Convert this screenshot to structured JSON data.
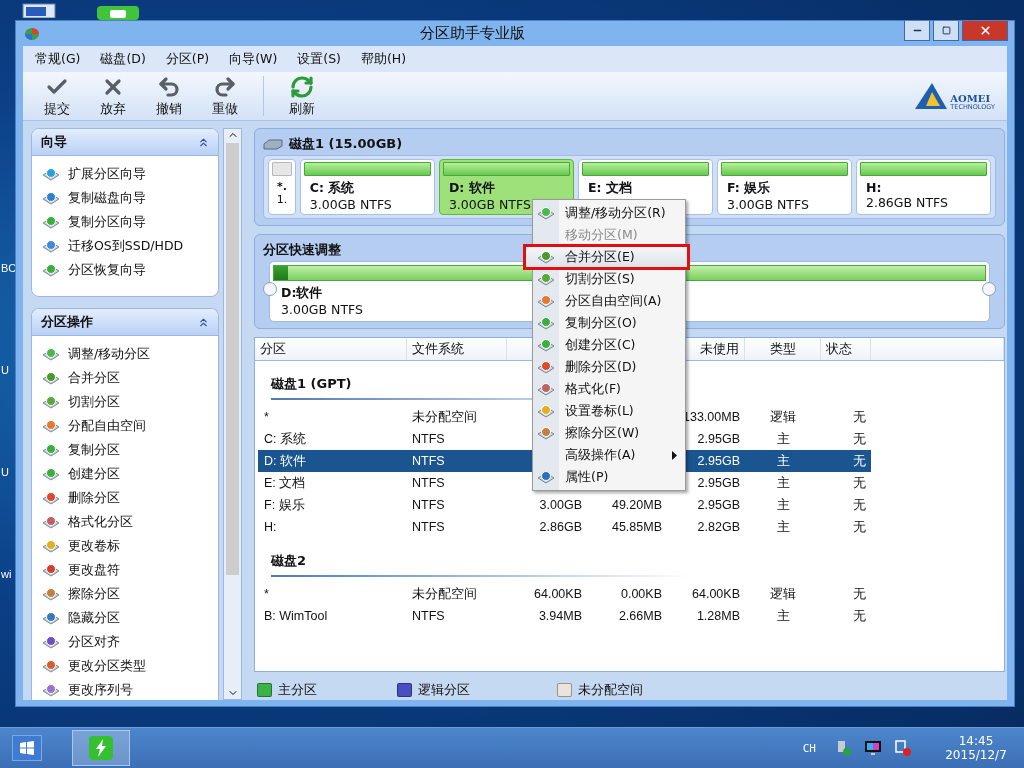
{
  "desktop_labels": [
    "BC",
    "U",
    "U",
    "wi"
  ],
  "window": {
    "title": "分区助手专业版"
  },
  "menu": [
    "常规(G)",
    "磁盘(D)",
    "分区(P)",
    "向导(W)",
    "设置(S)",
    "帮助(H)"
  ],
  "toolbar": [
    {
      "kind": "commit",
      "label": "提交"
    },
    {
      "kind": "discard",
      "label": "放弃"
    },
    {
      "kind": "undo",
      "label": "撤销"
    },
    {
      "kind": "redo",
      "label": "重做"
    },
    {
      "kind": "refresh",
      "label": "刷新"
    }
  ],
  "logo": {
    "name": "AOMEI",
    "tagline": "TECHNOLOGY"
  },
  "sidebar": [
    {
      "title": "向导",
      "expanded": true,
      "items": [
        {
          "kind": "extend",
          "label": "扩展分区向导"
        },
        {
          "kind": "copydisk",
          "label": "复制磁盘向导"
        },
        {
          "kind": "copy",
          "label": "复制分区向导"
        },
        {
          "kind": "migrate",
          "label": "迁移OS到SSD/HDD"
        },
        {
          "kind": "recover",
          "label": "分区恢复向导"
        }
      ]
    },
    {
      "title": "分区操作",
      "expanded": true,
      "items": [
        {
          "kind": "resize",
          "label": "调整/移动分区"
        },
        {
          "kind": "merge",
          "label": "合并分区"
        },
        {
          "kind": "split",
          "label": "切割分区"
        },
        {
          "kind": "allocate",
          "label": "分配自由空间"
        },
        {
          "kind": "copy",
          "label": "复制分区"
        },
        {
          "kind": "create",
          "label": "创建分区"
        },
        {
          "kind": "delete",
          "label": "删除分区"
        },
        {
          "kind": "format",
          "label": "格式化分区"
        },
        {
          "kind": "label",
          "label": "更改卷标"
        },
        {
          "kind": "letter",
          "label": "更改盘符"
        },
        {
          "kind": "wipe",
          "label": "擦除分区"
        },
        {
          "kind": "hide",
          "label": "隐藏分区"
        },
        {
          "kind": "align",
          "label": "分区对齐"
        },
        {
          "kind": "type",
          "label": "更改分区类型"
        },
        {
          "kind": "serial",
          "label": "更改序列号"
        }
      ]
    }
  ],
  "disk": {
    "title": "磁盘1 (15.00GB)",
    "partitions": [
      {
        "kind": "unallocated",
        "name": "*.",
        "info": "1.",
        "selected": false
      },
      {
        "kind": "primary",
        "name": "C: 系统",
        "info": "3.00GB NTFS",
        "selected": false
      },
      {
        "kind": "primary",
        "name": "D: 软件",
        "info": "3.00GB NTFS",
        "selected": true
      },
      {
        "kind": "primary",
        "name": "E: 文档",
        "selected": false
      },
      {
        "kind": "primary",
        "name": "F: 娱乐",
        "info": "3.00GB NTFS",
        "selected": false
      },
      {
        "kind": "primary",
        "name": "H:",
        "info": "2.86GB NTFS",
        "selected": false
      }
    ]
  },
  "quick_adjust": {
    "title": "分区快速调整",
    "name": "D:软件",
    "info": "3.00GB NTFS",
    "level": 0.02
  },
  "table": {
    "columns": [
      "分区",
      "文件系统",
      null,
      null,
      "未使用",
      "类型",
      "状态"
    ],
    "groups": [
      {
        "title": "磁盘1 (GPT)",
        "rows": [
          {
            "selected": false,
            "cells": [
              "*",
              "未分配空间",
              null,
              null,
              "133.00MB",
              "逻辑",
              "无"
            ]
          },
          {
            "selected": false,
            "cells": [
              "C: 系统",
              "NTFS",
              null,
              null,
              "2.95GB",
              "主",
              "无"
            ]
          },
          {
            "selected": true,
            "cells": [
              "D: 软件",
              "NTFS",
              null,
              null,
              "2.95GB",
              "主",
              "无"
            ]
          },
          {
            "selected": false,
            "cells": [
              "E: 文档",
              "NTFS",
              null,
              null,
              "2.95GB",
              "主",
              "无"
            ]
          },
          {
            "selected": false,
            "cells": [
              "F: 娱乐",
              "NTFS",
              "3.00GB",
              "49.20MB",
              "2.95GB",
              "主",
              "无"
            ]
          },
          {
            "selected": false,
            "cells": [
              "H:",
              "NTFS",
              "2.86GB",
              "45.85MB",
              "2.82GB",
              "主",
              "无"
            ]
          }
        ]
      },
      {
        "title": "磁盘2",
        "rows": [
          {
            "selected": false,
            "cells": [
              "*",
              "未分配空间",
              "64.00KB",
              "0.00KB",
              "64.00KB",
              "逻辑",
              "无"
            ]
          },
          {
            "selected": false,
            "cells": [
              "B: WimTool",
              "NTFS",
              "3.94MB",
              "2.66MB",
              "1.28MB",
              "主",
              "无"
            ]
          }
        ]
      }
    ]
  },
  "legend": [
    {
      "label": "主分区",
      "color": "#3cb34a"
    },
    {
      "label": "逻辑分区",
      "color": "#4a4fc0"
    },
    {
      "label": "未分配空间",
      "color": "#ece4dc"
    }
  ],
  "context_menu": [
    {
      "kind": "resize",
      "label": "调整/移动分区(R)",
      "disabled": false,
      "highlighted": false,
      "submenu": false
    },
    {
      "kind": "none",
      "label": "移动分区(M)",
      "disabled": true,
      "highlighted": false,
      "submenu": false
    },
    {
      "kind": "merge",
      "label": "合并分区(E)",
      "disabled": false,
      "highlighted": true,
      "submenu": false
    },
    {
      "kind": "split",
      "label": "切割分区(S)",
      "disabled": false,
      "highlighted": false,
      "submenu": false
    },
    {
      "kind": "allocate",
      "label": "分区自由空间(A)",
      "disabled": false,
      "highlighted": false,
      "submenu": false
    },
    {
      "kind": "copy",
      "label": "复制分区(O)",
      "disabled": false,
      "highlighted": false,
      "submenu": false
    },
    {
      "kind": "create",
      "label": "创建分区(C)",
      "disabled": false,
      "highlighted": false,
      "submenu": false
    },
    {
      "kind": "delete",
      "label": "删除分区(D)",
      "disabled": false,
      "highlighted": false,
      "submenu": false
    },
    {
      "kind": "format",
      "label": "格式化(F)",
      "disabled": false,
      "highlighted": false,
      "submenu": false
    },
    {
      "kind": "label",
      "label": "设置卷标(L)",
      "disabled": false,
      "highlighted": false,
      "submenu": false
    },
    {
      "kind": "wipe",
      "label": "擦除分区(W)",
      "disabled": false,
      "highlighted": false,
      "submenu": false
    },
    {
      "kind": "none",
      "label": "高级操作(A)",
      "disabled": false,
      "highlighted": false,
      "submenu": true
    },
    {
      "kind": "info",
      "label": "属性(P)",
      "disabled": false,
      "highlighted": false,
      "submenu": false
    }
  ],
  "taskbar": {
    "language": "CH",
    "time": "14:45",
    "date": "2015/12/7"
  }
}
